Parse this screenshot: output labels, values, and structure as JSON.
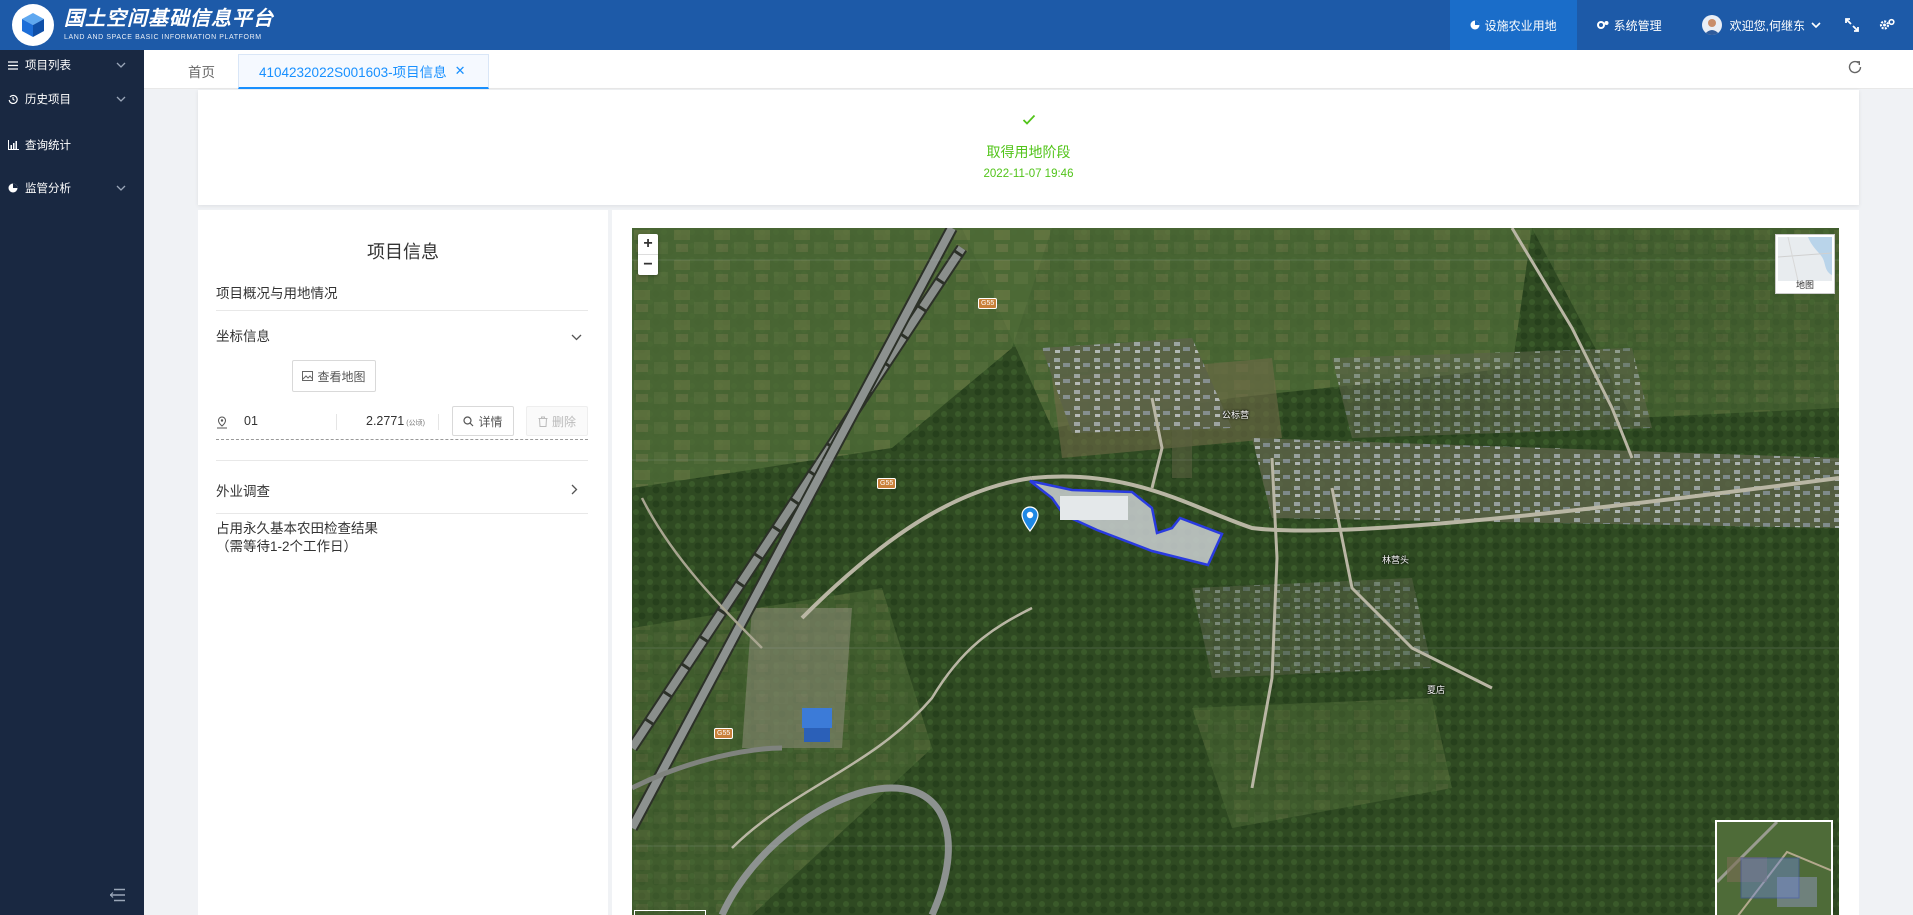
{
  "header": {
    "logo_title": "国土空间基础信息平台",
    "logo_subtitle": "LAND AND SPACE BASIC INFORMATION PLATFORM",
    "nav_active_label": "设施农业用地",
    "nav_system_label": "系统管理",
    "welcome_text": "欢迎您,何继东",
    "brand_color": "#1d5aa8"
  },
  "sidebar": {
    "items": [
      {
        "label": "项目列表",
        "icon": "list-icon",
        "has_submenu": true
      },
      {
        "label": "历史项目",
        "icon": "history-icon",
        "has_submenu": true
      },
      {
        "label": "查询统计",
        "icon": "bar-chart-icon",
        "has_submenu": false
      },
      {
        "label": "监管分析",
        "icon": "pie-chart-icon",
        "has_submenu": true
      }
    ]
  },
  "tabs": {
    "home_label": "首页",
    "active_label": "4104232022S001603-项目信息"
  },
  "stage": {
    "name": "取得用地阶段",
    "time": "2022-11-07 19:46",
    "color": "#52c41a"
  },
  "project": {
    "title": "项目信息",
    "overview_label": "项目概况与用地情况",
    "coords_label": "坐标信息",
    "view_map_label": "查看地图",
    "coord_row": {
      "id": "01",
      "area": "2.2771",
      "unit": "(公顷)",
      "detail_label": "详情",
      "delete_label": "删除"
    },
    "field_survey_label": "外业调查",
    "result_label_line1": "占用永久基本农田检查结果",
    "result_label_line2": "（需等待1-2个工作日）"
  },
  "map": {
    "zoom_in": "+",
    "zoom_out": "−",
    "layer_label": "地图",
    "road_number": "G55",
    "place_labels": [
      "公标营",
      "林营头",
      "夏店"
    ]
  }
}
